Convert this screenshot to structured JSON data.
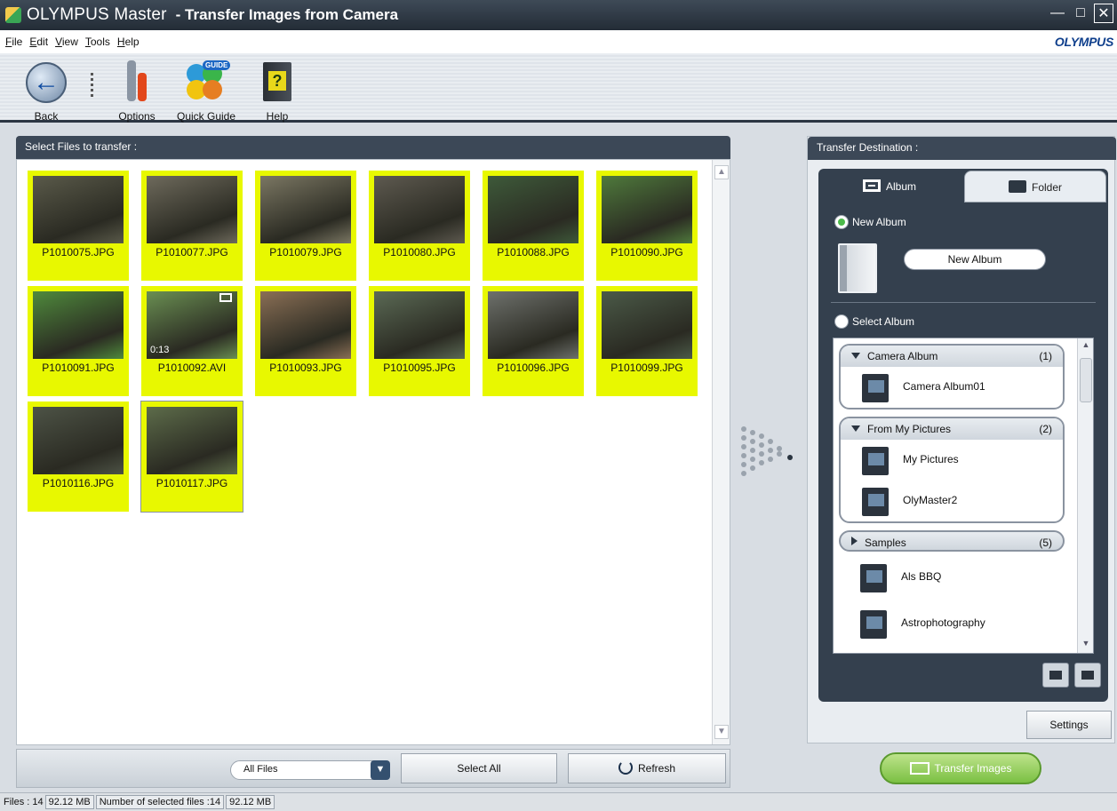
{
  "window": {
    "app_name": "OLYMPUS Master",
    "title": "- Transfer Images from Camera",
    "brand": "OLYMPUS"
  },
  "menu": [
    "File",
    "Edit",
    "View",
    "Tools",
    "Help"
  ],
  "toolbar": {
    "back": "Back",
    "options": "Options",
    "quick_guide": "Quick Guide",
    "guide_tag": "GUIDE",
    "help": "Help"
  },
  "left_panel": {
    "header": "Select Files to transfer :",
    "files": [
      {
        "name": "P1010075.JPG",
        "selected": true,
        "color": "#5a5a4a"
      },
      {
        "name": "P1010077.JPG",
        "selected": true,
        "color": "#6e6a5c"
      },
      {
        "name": "P1010079.JPG",
        "selected": true,
        "color": "#7b7763"
      },
      {
        "name": "P1010080.JPG",
        "selected": true,
        "color": "#5e5a50"
      },
      {
        "name": "P1010088.JPG",
        "selected": true,
        "color": "#3e5a3a"
      },
      {
        "name": "P1010090.JPG",
        "selected": true,
        "color": "#4f7a3c"
      },
      {
        "name": "P1010091.JPG",
        "selected": true,
        "color": "#4f8a3c"
      },
      {
        "name": "P1010092.AVI",
        "selected": true,
        "color": "#6a8f52",
        "duration": "0:13"
      },
      {
        "name": "P1010093.JPG",
        "selected": true,
        "color": "#8a6f55"
      },
      {
        "name": "P1010095.JPG",
        "selected": true,
        "color": "#5b6a55"
      },
      {
        "name": "P1010096.JPG",
        "selected": true,
        "color": "#6e716c"
      },
      {
        "name": "P1010099.JPG",
        "selected": true,
        "color": "#4b5a48"
      },
      {
        "name": "P1010116.JPG",
        "selected": true,
        "color": "#4d5346"
      },
      {
        "name": "P1010117.JPG",
        "selected": true,
        "color": "#5d6c4a"
      }
    ],
    "filter": "All Files",
    "select_all": "Select All",
    "refresh": "Refresh"
  },
  "right_panel": {
    "header": "Transfer Destination :",
    "tab_album": "Album",
    "tab_folder": "Folder",
    "new_album_label": "New Album",
    "new_album_value": "New Album",
    "select_album_label": "Select Album",
    "groups": [
      {
        "name": "Camera Album",
        "count": "(1)",
        "expanded": true,
        "albums": [
          "Camera Album01"
        ]
      },
      {
        "name": "From My Pictures",
        "count": "(2)",
        "expanded": true,
        "albums": [
          "My Pictures",
          "OlyMaster2"
        ]
      },
      {
        "name": "Samples",
        "count": "(5)",
        "expanded": false,
        "albums": [
          "Als BBQ",
          "Astrophotography"
        ]
      }
    ],
    "settings": "Settings"
  },
  "transfer_button": "Transfer Images",
  "status": {
    "files_label": "Files : 14",
    "files_size": "92.12 MB",
    "selected_label": "Number of selected files :14",
    "selected_size": "92.12 MB"
  }
}
